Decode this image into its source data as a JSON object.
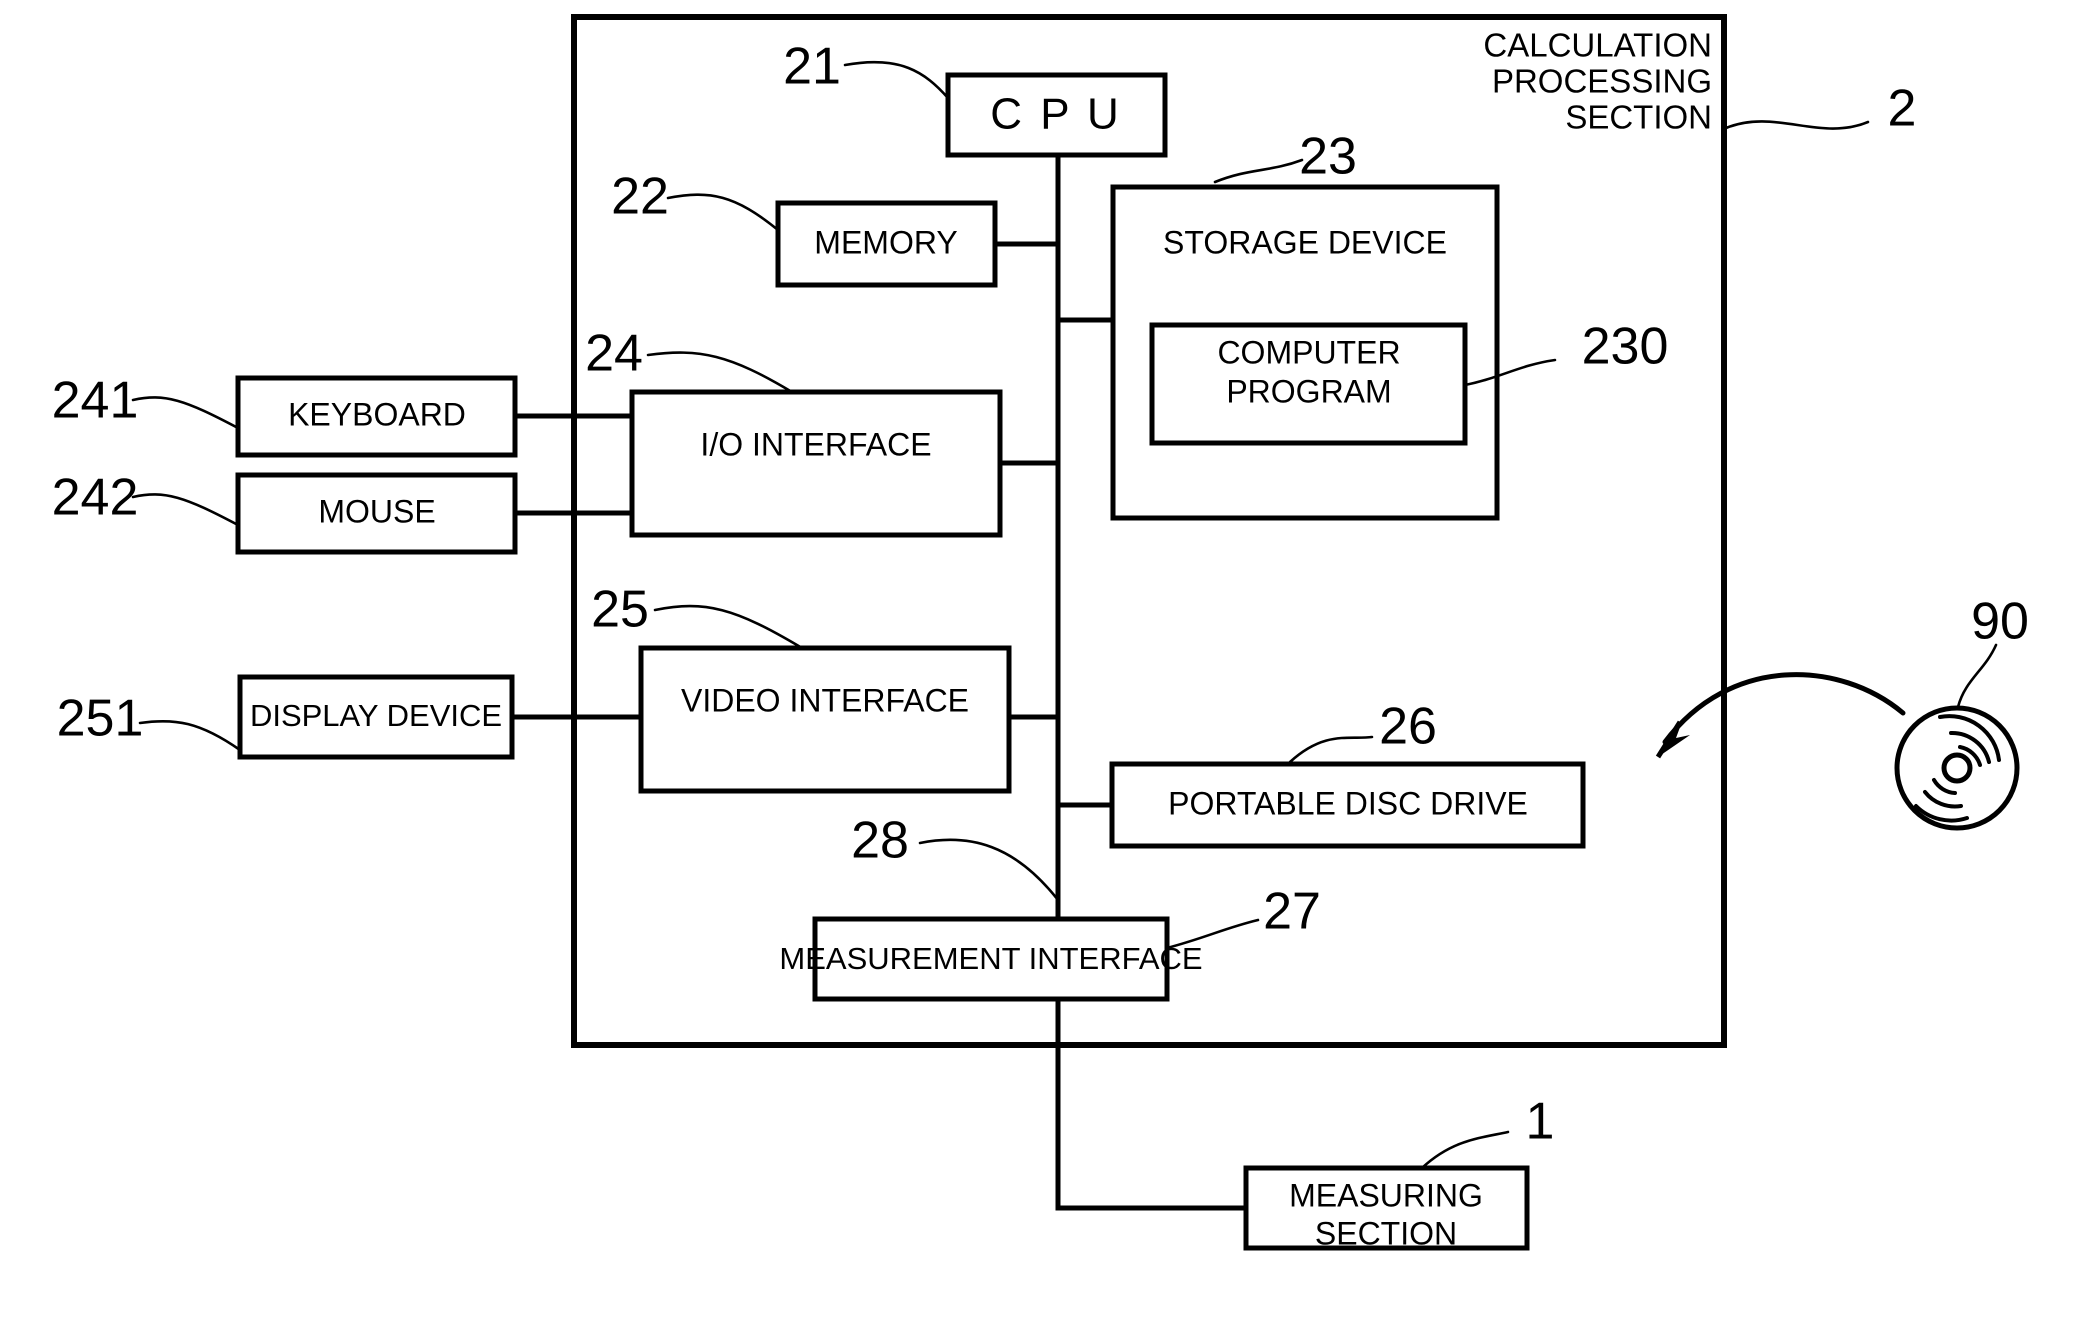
{
  "diagram": {
    "title": "Computer system block diagram",
    "outer_enclosure": {
      "label_lines": [
        "CALCULATION",
        "PROCESSING",
        "SECTION"
      ],
      "ref": "2"
    },
    "blocks": [
      {
        "id": "cpu",
        "label": "C P U",
        "ref": "21",
        "lines": [
          "C P U"
        ]
      },
      {
        "id": "memory",
        "label": "MEMORY",
        "ref": "22",
        "lines": [
          "MEMORY"
        ]
      },
      {
        "id": "storage-device",
        "label": "STORAGE DEVICE",
        "ref": "23",
        "lines": [
          "STORAGE DEVICE"
        ]
      },
      {
        "id": "computer-program",
        "label": "COMPUTER PROGRAM",
        "ref": "230",
        "lines": [
          "COMPUTER",
          "PROGRAM"
        ]
      },
      {
        "id": "io-interface",
        "label": "I/O INTERFACE",
        "ref": "24",
        "lines": [
          "I/O INTERFACE"
        ]
      },
      {
        "id": "keyboard",
        "label": "KEYBOARD",
        "ref": "241",
        "lines": [
          "KEYBOARD"
        ]
      },
      {
        "id": "mouse",
        "label": "MOUSE",
        "ref": "242",
        "lines": [
          "MOUSE"
        ]
      },
      {
        "id": "video-interface",
        "label": "VIDEO INTERFACE",
        "ref": "25",
        "lines": [
          "VIDEO INTERFACE"
        ]
      },
      {
        "id": "display-device",
        "label": "DISPLAY DEVICE",
        "ref": "251",
        "lines": [
          "DISPLAY DEVICE"
        ]
      },
      {
        "id": "portable-disc-drive",
        "label": "PORTABLE DISC DRIVE",
        "ref": "26",
        "lines": [
          "PORTABLE DISC DRIVE"
        ]
      },
      {
        "id": "measurement-interface",
        "label": "MEASUREMENT INTERFACE",
        "ref": "27",
        "lines": [
          "MEASUREMENT INTERFACE"
        ]
      },
      {
        "id": "measuring-section",
        "label": "MEASURING SECTION",
        "ref": "1",
        "lines": [
          "MEASURING",
          "SECTION"
        ]
      }
    ],
    "bus": {
      "id": "system-bus",
      "ref": "28"
    },
    "portable_disc": {
      "id": "portable-disc",
      "ref": "90",
      "label": "portable disc"
    },
    "colors": {
      "ink": "#000000",
      "paper": "#ffffff"
    }
  },
  "text": {
    "cpu": "C P U",
    "memory": "MEMORY",
    "storage_device": "STORAGE DEVICE",
    "computer_program_l1": "COMPUTER",
    "computer_program_l2": "PROGRAM",
    "io_interface": "I/O INTERFACE",
    "keyboard": "KEYBOARD",
    "mouse": "MOUSE",
    "video_interface": "VIDEO INTERFACE",
    "display_device": "DISPLAY DEVICE",
    "portable_disc_drive": "PORTABLE DISC DRIVE",
    "measurement_interface": "MEASUREMENT INTERFACE",
    "measuring_section_l1": "MEASURING",
    "measuring_section_l2": "SECTION",
    "enclosure_l1": "CALCULATION",
    "enclosure_l2": "PROCESSING",
    "enclosure_l3": "SECTION"
  },
  "refs": {
    "r1": "1",
    "r2": "2",
    "r21": "21",
    "r22": "22",
    "r23": "23",
    "r230": "230",
    "r24": "24",
    "r241": "241",
    "r242": "242",
    "r25": "25",
    "r251": "251",
    "r26": "26",
    "r27": "27",
    "r28": "28",
    "r90": "90"
  }
}
